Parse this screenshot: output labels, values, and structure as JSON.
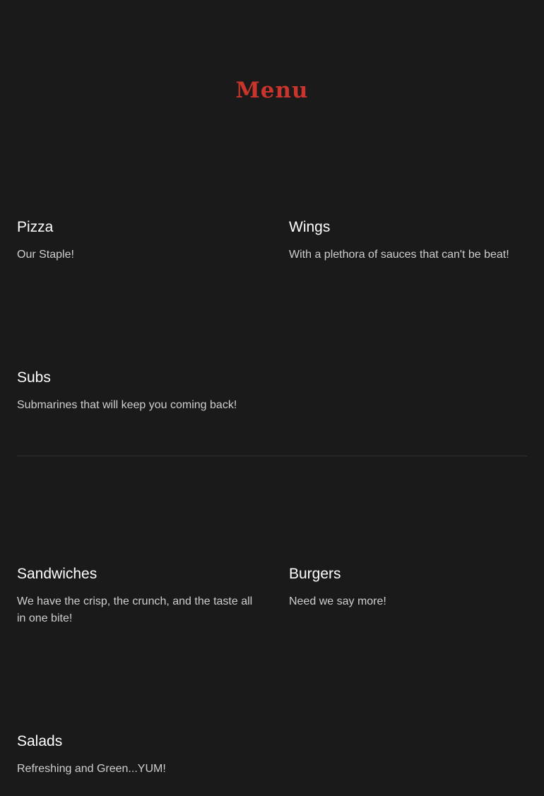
{
  "header": {
    "title": "Menu",
    "title_color": "#c9342c"
  },
  "menu": {
    "items": [
      {
        "name": "Pizza",
        "description": "Our Staple!"
      },
      {
        "name": "Wings",
        "description": "With a plethora of sauces that can't be beat!"
      },
      {
        "name": "Subs",
        "description": "Submarines that will keep you coming back!"
      },
      {
        "name": "Sandwiches",
        "description": "We have the crisp, the crunch, and the taste all in one bite!"
      },
      {
        "name": "Burgers",
        "description": "Need we say more!"
      },
      {
        "name": "Salads",
        "description": "Refreshing and Green...YUM!"
      }
    ]
  }
}
